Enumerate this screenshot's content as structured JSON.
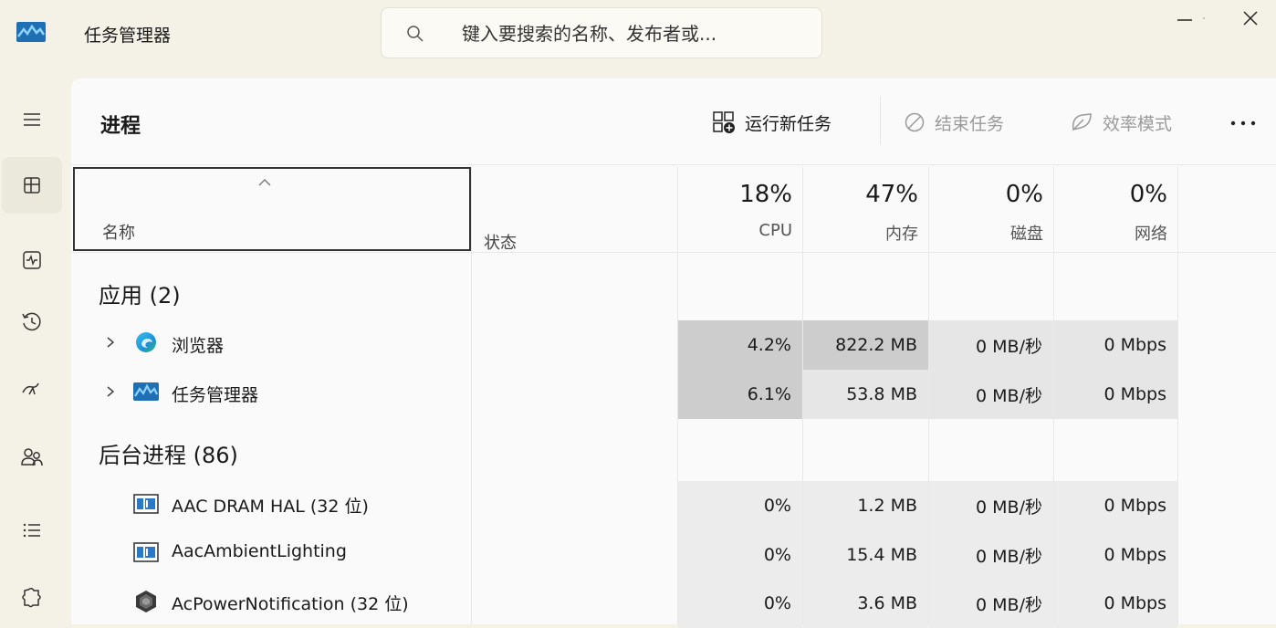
{
  "app": {
    "title": "任务管理器"
  },
  "search": {
    "placeholder": "键入要搜索的名称、发布者或..."
  },
  "toolbar": {
    "page_title": "进程",
    "run_new_task": "运行新任务",
    "end_task": "结束任务",
    "efficiency_mode": "效率模式"
  },
  "columns": {
    "name": "名称",
    "status": "状态",
    "cpu": {
      "percent": "18%",
      "label": "CPU"
    },
    "memory": {
      "percent": "47%",
      "label": "内存"
    },
    "disk": {
      "percent": "0%",
      "label": "磁盘"
    },
    "network": {
      "percent": "0%",
      "label": "网络"
    }
  },
  "groups": {
    "apps": {
      "title": "应用 (2)",
      "rows": [
        {
          "name": "浏览器",
          "icon": "edge-browser-icon",
          "cpu": "4.2%",
          "memory": "822.2 MB",
          "disk": "0 MB/秒",
          "network": "0 Mbps"
        },
        {
          "name": "任务管理器",
          "icon": "task-manager-icon",
          "cpu": "6.1%",
          "memory": "53.8 MB",
          "disk": "0 MB/秒",
          "network": "0 Mbps"
        }
      ]
    },
    "background": {
      "title": "后台进程 (86)",
      "rows": [
        {
          "name": "AAC DRAM HAL (32 位)",
          "icon": "window-app-icon",
          "cpu": "0%",
          "memory": "1.2 MB",
          "disk": "0 MB/秒",
          "network": "0 Mbps"
        },
        {
          "name": "AacAmbientLighting",
          "icon": "window-app-icon",
          "cpu": "0%",
          "memory": "15.4 MB",
          "disk": "0 MB/秒",
          "network": "0 Mbps"
        },
        {
          "name": "AcPowerNotification (32 位)",
          "icon": "power-notification-icon",
          "cpu": "0%",
          "memory": "3.6 MB",
          "disk": "0 MB/秒",
          "network": "0 Mbps"
        }
      ]
    }
  },
  "colors": {
    "accent": "#0067c0",
    "cpu_heat_high": "#cdcdcd",
    "cell_heat": "#e6e6e6"
  }
}
